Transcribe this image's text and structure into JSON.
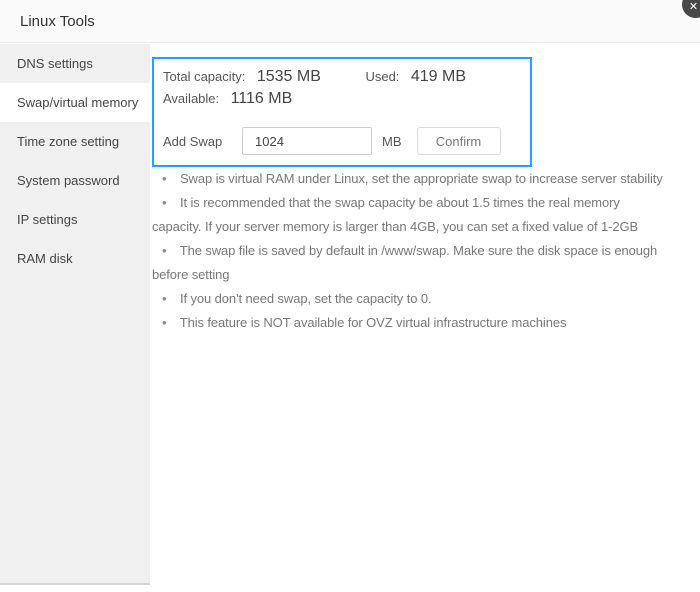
{
  "window": {
    "title": "Linux Tools",
    "close_icon": "✕"
  },
  "sidebar": {
    "items": [
      {
        "label": "DNS settings",
        "selected": false
      },
      {
        "label": "Swap/virtual memory",
        "selected": true
      },
      {
        "label": "Time zone setting",
        "selected": false
      },
      {
        "label": "System password",
        "selected": false
      },
      {
        "label": "IP settings",
        "selected": false
      },
      {
        "label": "RAM disk",
        "selected": false
      }
    ]
  },
  "swap_panel": {
    "accent_color": "#20a0ff",
    "stats": [
      {
        "label": "Total capacity:",
        "value": "1535 MB"
      },
      {
        "label": "Used:",
        "value": "419 MB"
      },
      {
        "label": "Available:",
        "value": "1116 MB"
      }
    ],
    "add_swap": {
      "label": "Add Swap",
      "input_value": "1024",
      "unit": "MB",
      "confirm_label": "Confirm"
    }
  },
  "notes": [
    {
      "lines": [
        "Swap is virtual RAM under Linux, set the appropriate swap to increase server stability"
      ]
    },
    {
      "lines": [
        "It is recommended that the swap capacity be about 1.5 times the real memory",
        "capacity. If your server memory is larger than 4GB, you can set a fixed value of 1-2GB"
      ]
    },
    {
      "lines": [
        "The swap file is saved by default in /www/swap. Make sure the disk space is enough",
        "before setting"
      ]
    },
    {
      "lines": [
        "If you don't need swap, set the capacity to 0."
      ]
    },
    {
      "lines": [
        "This feature is NOT available for OVZ virtual infrastructure machines"
      ]
    }
  ]
}
